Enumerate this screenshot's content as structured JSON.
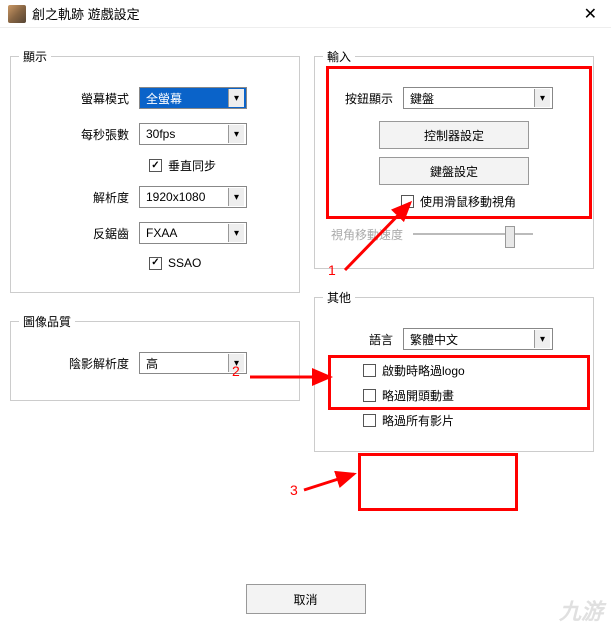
{
  "window": {
    "title": "創之軌跡 遊戲設定"
  },
  "display": {
    "legend": "顯示",
    "screen_mode_label": "螢幕模式",
    "screen_mode_value": "全螢幕",
    "fps_label": "每秒張數",
    "fps_value": "30fps",
    "vsync_label": "垂直同步",
    "vsync_checked": true,
    "resolution_label": "解析度",
    "resolution_value": "1920x1080",
    "aa_label": "反鋸齒",
    "aa_value": "FXAA",
    "ssao_label": "SSAO",
    "ssao_checked": true
  },
  "image_quality": {
    "legend": "圖像品質",
    "shadow_label": "陰影解析度",
    "shadow_value": "高"
  },
  "input": {
    "legend": "輸入",
    "button_display_label": "按鈕顯示",
    "button_display_value": "鍵盤",
    "controller_btn": "控制器設定",
    "keyboard_btn": "鍵盤設定",
    "mouse_view_label": "使用滑鼠移動視角",
    "mouse_view_checked": false,
    "camera_speed_label": "視角移動速度"
  },
  "other": {
    "legend": "其他",
    "language_label": "語言",
    "language_value": "繁體中文",
    "skip_logo_label": "啟動時略過logo",
    "skip_logo_checked": false,
    "skip_opening_label": "略過開頭動畫",
    "skip_opening_checked": false,
    "skip_videos_label": "略過所有影片",
    "skip_videos_checked": false
  },
  "footer": {
    "cancel": "取消"
  },
  "annotations": {
    "n1": "1",
    "n2": "2",
    "n3": "3"
  },
  "watermark": "九游"
}
